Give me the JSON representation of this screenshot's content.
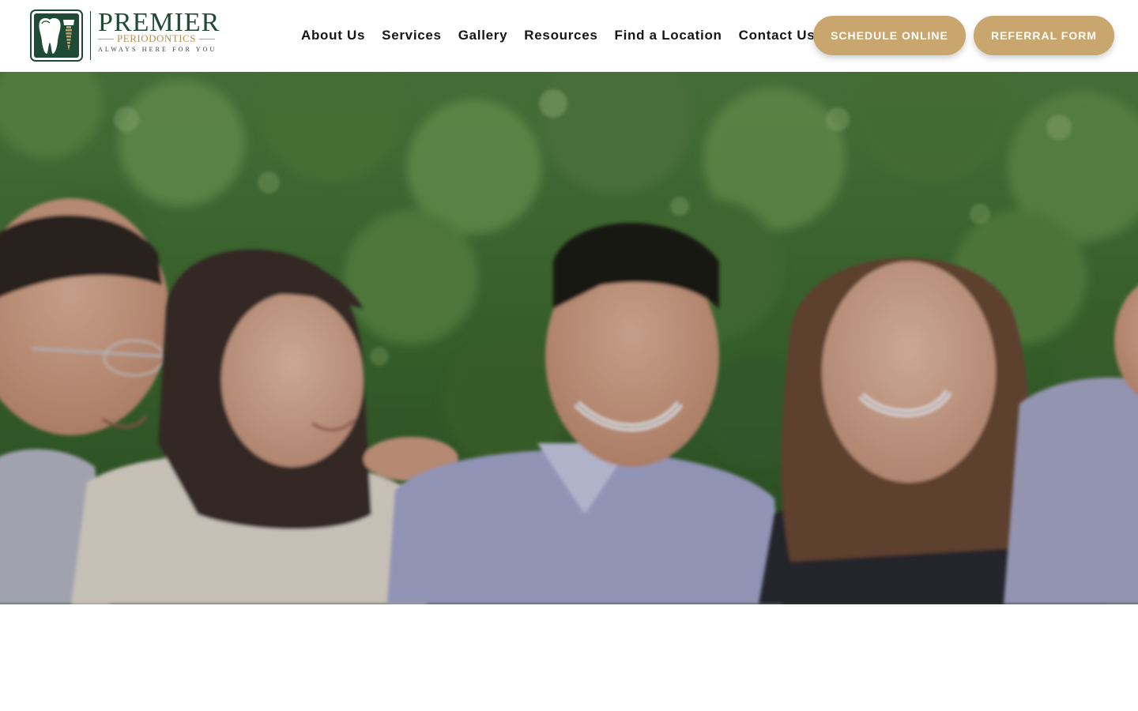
{
  "brand": {
    "name": "PREMIER",
    "sub": "PERIODONTICS",
    "tagline": "ALWAYS HERE FOR YOU",
    "green": "#1f4a35",
    "gold": "#c9a66e"
  },
  "nav": {
    "items": [
      {
        "label": "About Us"
      },
      {
        "label": "Services"
      },
      {
        "label": "Gallery"
      },
      {
        "label": "Resources"
      },
      {
        "label": "Find a Location"
      },
      {
        "label": "Contact Us"
      }
    ]
  },
  "cta": {
    "schedule": "SCHEDULE ONLINE",
    "referral": "REFERRAL FORM"
  }
}
